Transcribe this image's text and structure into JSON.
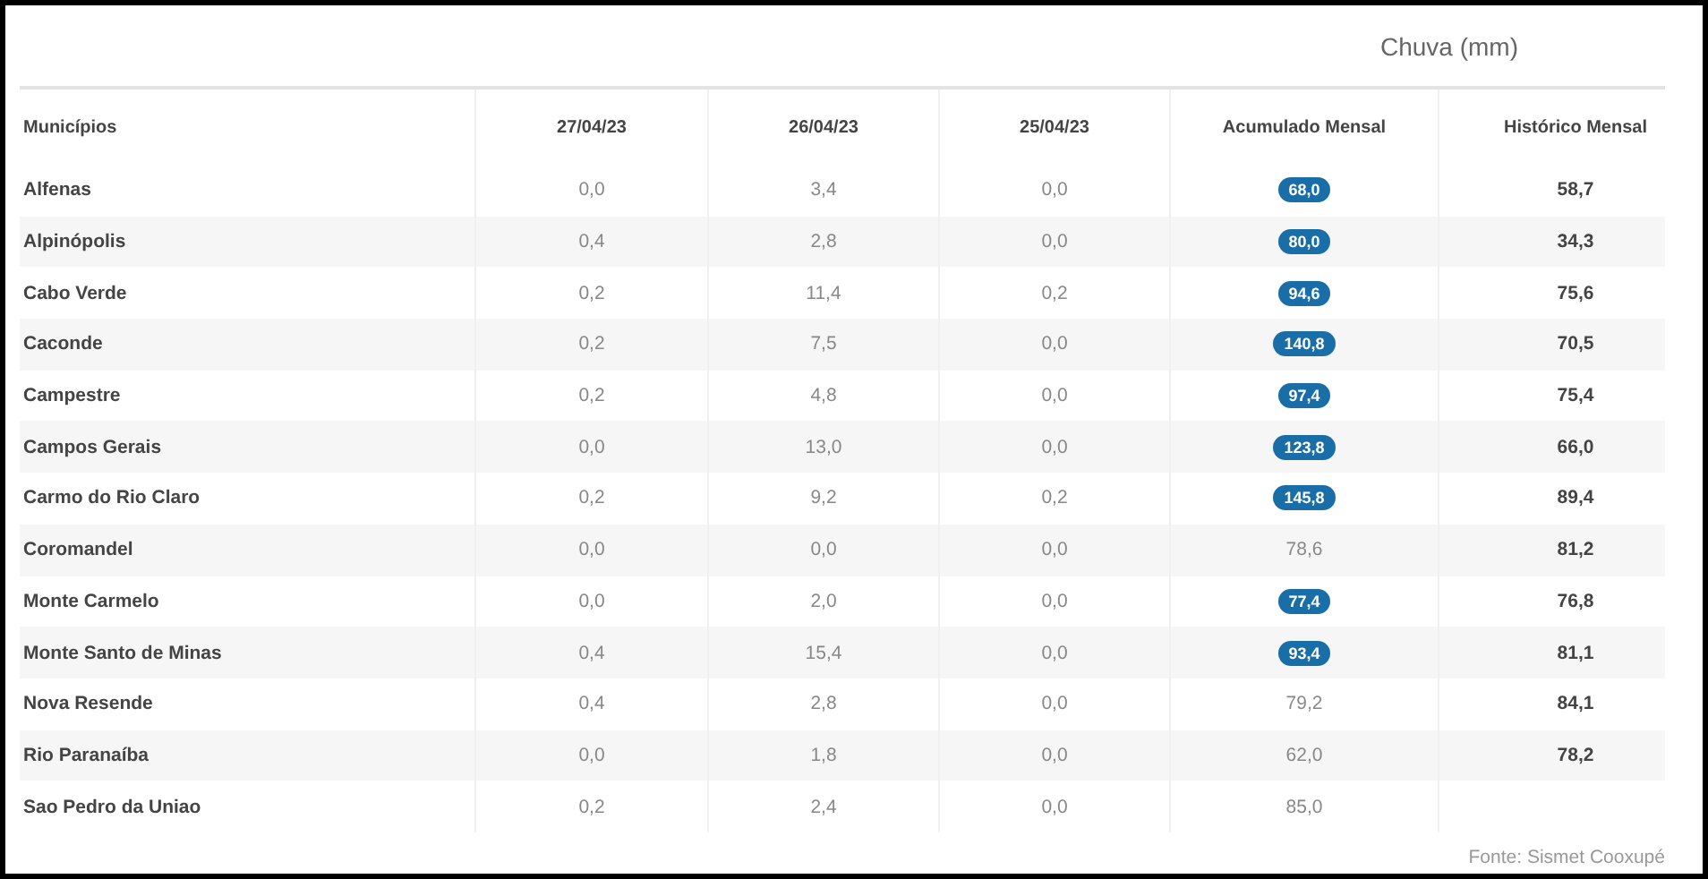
{
  "title": "Chuva (mm)",
  "columns": [
    "Municípios",
    "27/04/23",
    "26/04/23",
    "25/04/23",
    "Acumulado Mensal",
    "Histórico Mensal"
  ],
  "rows": [
    {
      "city": "Alfenas",
      "d1": "0,0",
      "d2": "3,4",
      "d3": "0,0",
      "accumulated": "68,0",
      "highlighted": true,
      "historic": "58,7"
    },
    {
      "city": "Alpinópolis",
      "d1": "0,4",
      "d2": "2,8",
      "d3": "0,0",
      "accumulated": "80,0",
      "highlighted": true,
      "historic": "34,3"
    },
    {
      "city": "Cabo Verde",
      "d1": "0,2",
      "d2": "11,4",
      "d3": "0,2",
      "accumulated": "94,6",
      "highlighted": true,
      "historic": "75,6"
    },
    {
      "city": "Caconde",
      "d1": "0,2",
      "d2": "7,5",
      "d3": "0,0",
      "accumulated": "140,8",
      "highlighted": true,
      "historic": "70,5"
    },
    {
      "city": "Campestre",
      "d1": "0,2",
      "d2": "4,8",
      "d3": "0,0",
      "accumulated": "97,4",
      "highlighted": true,
      "historic": "75,4"
    },
    {
      "city": "Campos Gerais",
      "d1": "0,0",
      "d2": "13,0",
      "d3": "0,0",
      "accumulated": "123,8",
      "highlighted": true,
      "historic": "66,0"
    },
    {
      "city": "Carmo do Rio Claro",
      "d1": "0,2",
      "d2": "9,2",
      "d3": "0,2",
      "accumulated": "145,8",
      "highlighted": true,
      "historic": "89,4"
    },
    {
      "city": "Coromandel",
      "d1": "0,0",
      "d2": "0,0",
      "d3": "0,0",
      "accumulated": "78,6",
      "highlighted": false,
      "historic": "81,2"
    },
    {
      "city": "Monte Carmelo",
      "d1": "0,0",
      "d2": "2,0",
      "d3": "0,0",
      "accumulated": "77,4",
      "highlighted": true,
      "historic": "76,8"
    },
    {
      "city": "Monte Santo de Minas",
      "d1": "0,4",
      "d2": "15,4",
      "d3": "0,0",
      "accumulated": "93,4",
      "highlighted": true,
      "historic": "81,1"
    },
    {
      "city": "Nova Resende",
      "d1": "0,4",
      "d2": "2,8",
      "d3": "0,0",
      "accumulated": "79,2",
      "highlighted": false,
      "historic": "84,1"
    },
    {
      "city": "Rio Paranaíba",
      "d1": "0,0",
      "d2": "1,8",
      "d3": "0,0",
      "accumulated": "62,0",
      "highlighted": false,
      "historic": "78,2"
    },
    {
      "city": "Sao Pedro da Uniao",
      "d1": "0,2",
      "d2": "2,4",
      "d3": "0,0",
      "accumulated": "85,0",
      "highlighted": false
    }
  ],
  "source": "Fonte: Sismet Cooxupé"
}
